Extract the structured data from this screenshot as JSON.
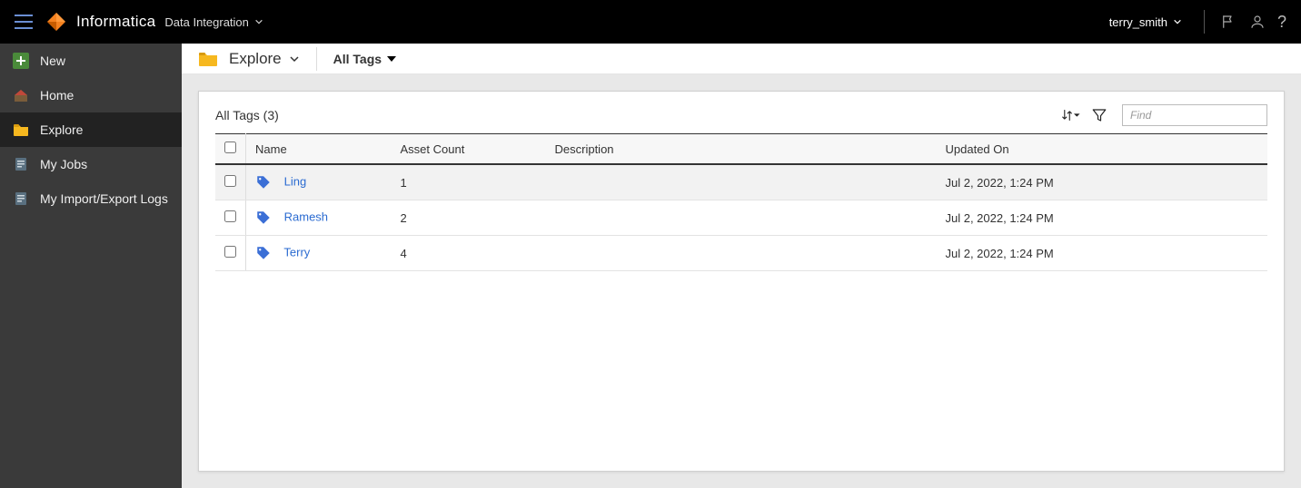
{
  "header": {
    "brand": "Informatica",
    "product": "Data Integration",
    "user": "terry_smith"
  },
  "sidebar": {
    "items": [
      {
        "label": "New"
      },
      {
        "label": "Home"
      },
      {
        "label": "Explore"
      },
      {
        "label": "My Jobs"
      },
      {
        "label": "My Import/Export Logs"
      }
    ]
  },
  "breadcrumb": {
    "root": "Explore",
    "filter": "All Tags"
  },
  "panel": {
    "title": "All Tags (3)",
    "find_placeholder": "Find"
  },
  "table": {
    "columns": {
      "name": "Name",
      "asset_count": "Asset Count",
      "description": "Description",
      "updated_on": "Updated On"
    },
    "rows": [
      {
        "name": "Ling",
        "asset_count": "1",
        "description": "",
        "updated_on": "Jul 2, 2022, 1:24 PM"
      },
      {
        "name": "Ramesh",
        "asset_count": "2",
        "description": "",
        "updated_on": "Jul 2, 2022, 1:24 PM"
      },
      {
        "name": "Terry",
        "asset_count": "4",
        "description": "",
        "updated_on": "Jul 2, 2022, 1:24 PM"
      }
    ]
  }
}
